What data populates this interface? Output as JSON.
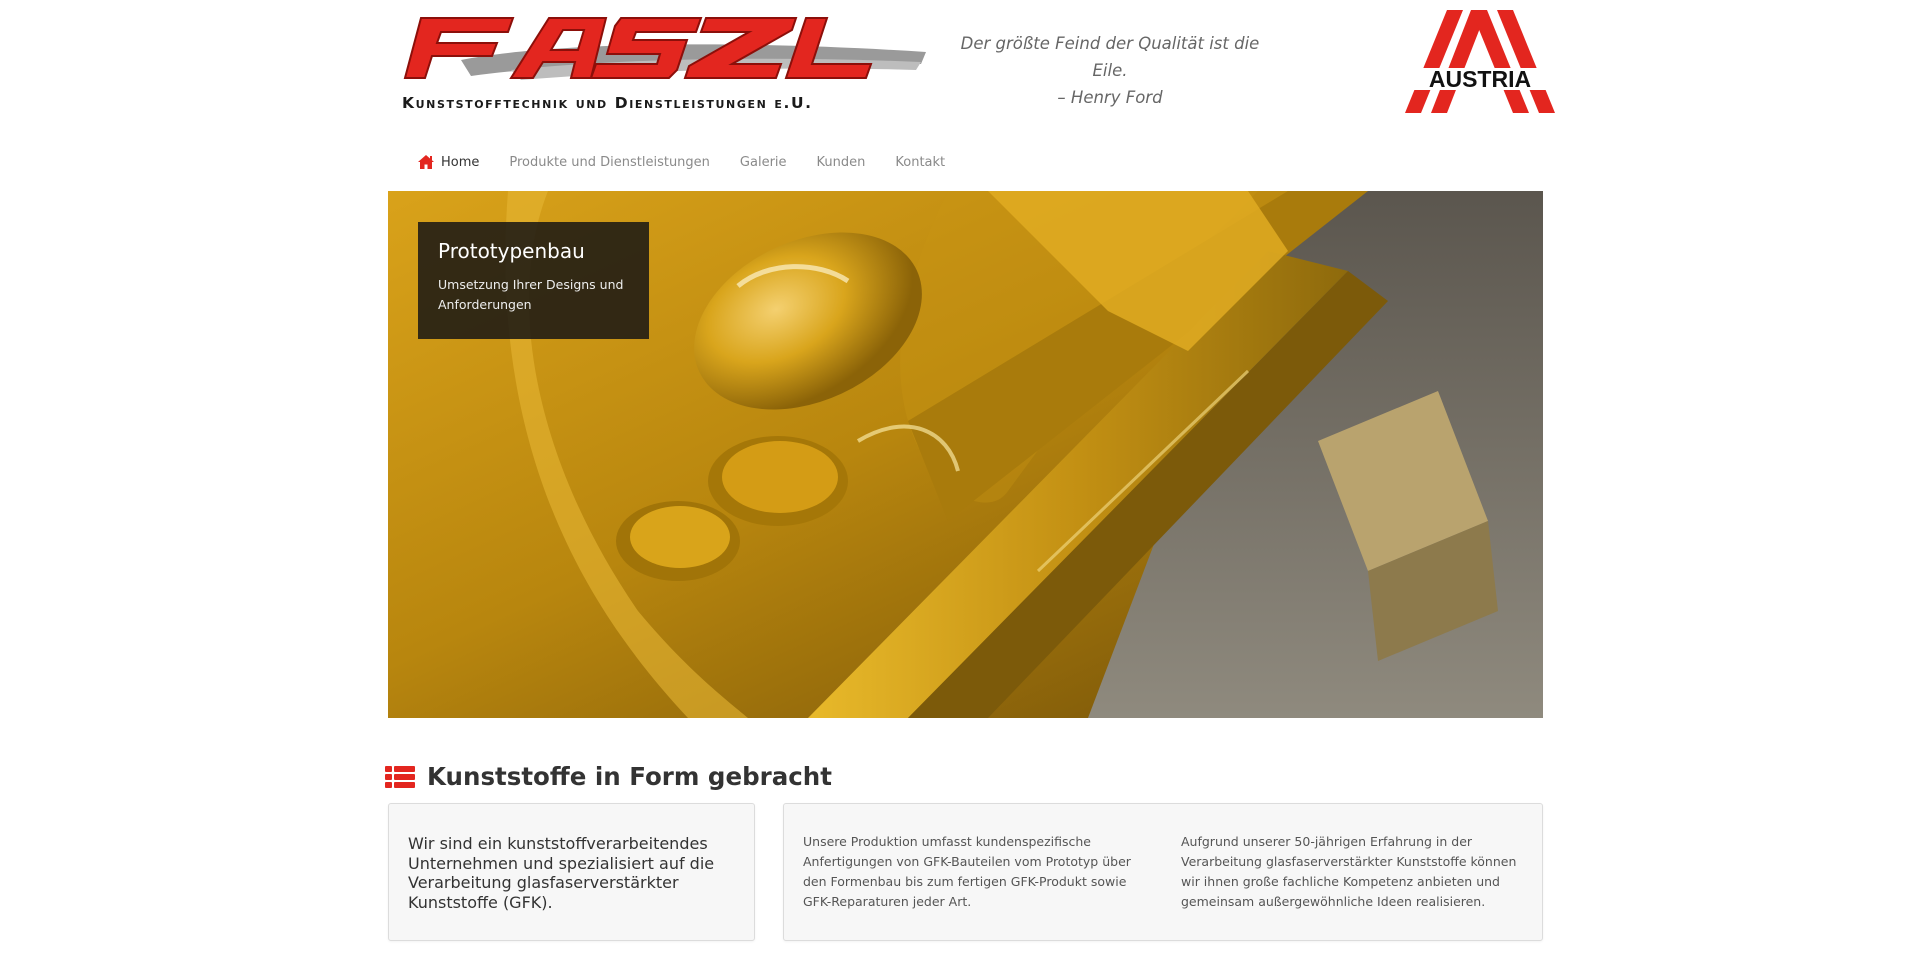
{
  "header": {
    "logo_text": "FASZL",
    "logo_subtitle": "Kunststofftechnik und Dienstleistungen e.U.",
    "quote_line1": "Der größte Feind der Qualität ist die Eile.",
    "quote_line2": "– Henry Ford",
    "austria_label": "AUSTRIA"
  },
  "nav": {
    "items": [
      {
        "label": "Home",
        "icon": "home-icon",
        "active": true
      },
      {
        "label": "Produkte und Dienstleistungen"
      },
      {
        "label": "Galerie"
      },
      {
        "label": "Kunden"
      },
      {
        "label": "Kontakt"
      }
    ]
  },
  "hero": {
    "caption_title": "Prototypenbau",
    "caption_text": "Umsetzung Ihrer Designs und Anforderungen"
  },
  "section": {
    "icon": "list-icon",
    "title": "Kunststoffe in Form gebracht",
    "intro": "Wir sind ein kunststoffverarbeitendes Unternehmen und spezialisiert auf die Verarbeitung glasfaserverstärkter Kunststoffe (GFK).",
    "col1": "Unsere Produktion umfasst kundenspezifische Anfertigungen von GFK-Bauteilen vom Prototyp über den Formenbau bis zum fertigen GFK-Produkt sowie GFK-Reparaturen jeder Art.",
    "col2": "Aufgrund unserer 50-jährigen Erfahrung in der Verarbeitung glasfaserverstärkter Kunststoffe können wir ihnen große fachliche Kompetenz anbieten und gemeinsam außergewöhnliche Ideen realisieren."
  },
  "colors": {
    "brand_red": "#e3261f",
    "text_dark": "#333333",
    "nav_muted": "#8a8a8a"
  }
}
